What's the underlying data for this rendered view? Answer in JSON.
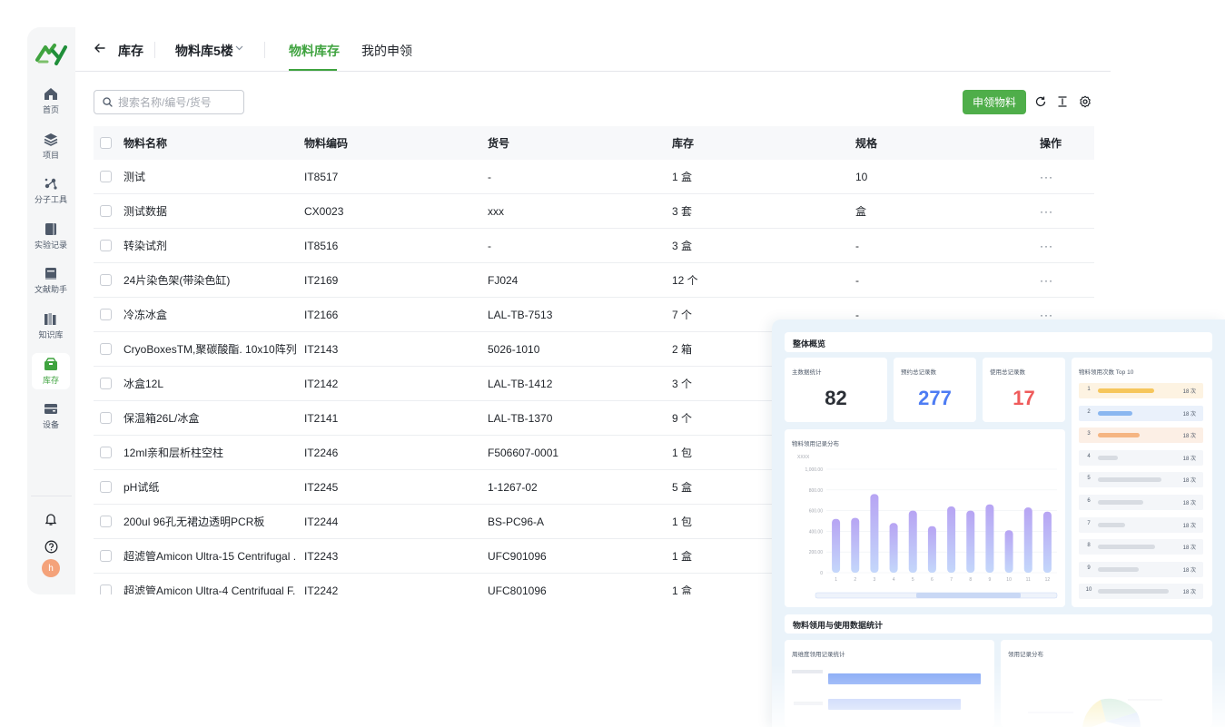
{
  "sidebar": {
    "items": [
      {
        "label": "首页",
        "icon": "home-icon"
      },
      {
        "label": "项目",
        "icon": "layers-icon"
      },
      {
        "label": "分子工具",
        "icon": "molecule-icon"
      },
      {
        "label": "实验记录",
        "icon": "notebook-icon"
      },
      {
        "label": "文献助手",
        "icon": "book-icon"
      },
      {
        "label": "知识库",
        "icon": "books-icon"
      },
      {
        "label": "库存",
        "icon": "inventory-icon",
        "active": true
      },
      {
        "label": "设备",
        "icon": "device-icon"
      }
    ],
    "avatar_letter": "h",
    "accent": "#3fa33f"
  },
  "header": {
    "breadcrumb": "库存",
    "warehouse": "物料库5楼",
    "tabs": [
      {
        "label": "物料库存",
        "active": true
      },
      {
        "label": "我的申领",
        "active": false
      }
    ]
  },
  "toolbar": {
    "search_placeholder": "搜索名称/编号/货号",
    "apply_label": "申领物料",
    "apply_color": "#4fae4a"
  },
  "table": {
    "columns": [
      "物料名称",
      "物料编码",
      "货号",
      "库存",
      "规格",
      "操作"
    ],
    "rows": [
      {
        "name": "测试",
        "code": "IT8517",
        "sku": "-",
        "stock": "1 盒",
        "spec": "10",
        "ops": "···"
      },
      {
        "name": "测试数据",
        "code": "CX0023",
        "sku": "xxx",
        "stock": "3 套",
        "spec": "盒",
        "ops": "···"
      },
      {
        "name": "转染试剂",
        "code": "IT8516",
        "sku": "-",
        "stock": "3 盒",
        "spec": "-",
        "ops": "···"
      },
      {
        "name": "24片染色架(带染色缸)",
        "code": "IT2169",
        "sku": "FJ024",
        "stock": "12 个",
        "spec": "-",
        "ops": "···"
      },
      {
        "name": "冷冻冰盒",
        "code": "IT2166",
        "sku": "LAL-TB-7513",
        "stock": "7 个",
        "spec": "-",
        "ops": "···"
      },
      {
        "name": "CryoBoxesTM,聚碳酸酯. 10x10阵列,...",
        "code": "IT2143",
        "sku": "5026-1010",
        "stock": "2 箱",
        "spec": "",
        "ops": ""
      },
      {
        "name": "冰盒12L",
        "code": "IT2142",
        "sku": "LAL-TB-1412",
        "stock": "3 个",
        "spec": "",
        "ops": ""
      },
      {
        "name": "保温箱26L/冰盒",
        "code": "IT2141",
        "sku": " LAL-TB-1370",
        "stock": "9 个",
        "spec": "",
        "ops": ""
      },
      {
        "name": "12ml亲和层析柱空柱",
        "code": "IT2246",
        "sku": "F506607-0001",
        "stock": "1 包",
        "spec": "",
        "ops": ""
      },
      {
        "name": "pH试纸",
        "code": "IT2245",
        "sku": "1-1267-02",
        "stock": "5 盒",
        "spec": "",
        "ops": ""
      },
      {
        "name": "200ul 96孔无裙边透明PCR板",
        "code": "IT2244",
        "sku": "BS-PC96-A",
        "stock": "1 包",
        "spec": "",
        "ops": ""
      },
      {
        "name": "超滤管Amicon Ultra-15 Centrifugal ...",
        "code": "IT2243",
        "sku": "UFC901096",
        "stock": "1 盒",
        "spec": "",
        "ops": ""
      },
      {
        "name": "超滤管Amicon Ultra-4 Centrifugal F...",
        "code": "IT2242",
        "sku": "UFC801096",
        "stock": "1 盒",
        "spec": "",
        "ops": ""
      }
    ]
  },
  "dashboard": {
    "overview_title": "整体概览",
    "stats": [
      {
        "label": "主数据统计",
        "value": "82",
        "color": "#2b2f36"
      },
      {
        "label": "预约总记录数",
        "value": "277",
        "color": "#4d7cf3"
      },
      {
        "label": "使用总记录数",
        "value": "17",
        "color": "#ef5b5b"
      }
    ],
    "top10": {
      "title": "物料领用次数 Top 10",
      "items": [
        {
          "rank": "1",
          "count": "18 次",
          "level": 0.62,
          "color": "#f6c65b",
          "bg": "#fdf3e2"
        },
        {
          "rank": "2",
          "count": "18 次",
          "level": 0.38,
          "color": "#8ab7f0",
          "bg": "#eaf1fb"
        },
        {
          "rank": "3",
          "count": "18 次",
          "level": 0.46,
          "color": "#f5b582",
          "bg": "#fcefe5"
        },
        {
          "rank": "4",
          "count": "18 次",
          "level": 0.22,
          "color": "#d8dce2",
          "bg": "#f4f6f9"
        },
        {
          "rank": "5",
          "count": "18 次",
          "level": 0.7,
          "color": "#d8dce2",
          "bg": "#f4f6f9"
        },
        {
          "rank": "6",
          "count": "18 次",
          "level": 0.5,
          "color": "#d8dce2",
          "bg": "#f4f6f9"
        },
        {
          "rank": "7",
          "count": "18 次",
          "level": 0.3,
          "color": "#d8dce2",
          "bg": "#f4f6f9"
        },
        {
          "rank": "8",
          "count": "18 次",
          "level": 0.63,
          "color": "#d8dce2",
          "bg": "#f4f6f9"
        },
        {
          "rank": "9",
          "count": "18 次",
          "level": 0.45,
          "color": "#d8dce2",
          "bg": "#f4f6f9"
        },
        {
          "rank": "10",
          "count": "18 次",
          "level": 0.78,
          "color": "#d8dce2",
          "bg": "#f4f6f9"
        }
      ]
    },
    "monthly_title": "物料领用记录分布",
    "stats_title": "物料领用与使用数据统计",
    "weekly_title": "周维度领用记录统计",
    "dist_title": "领用记录分布"
  },
  "chart_data": {
    "type": "bar",
    "title": "物料领用记录分布",
    "ylabel": "XXXX",
    "categories": [
      "1",
      "2",
      "3",
      "4",
      "5",
      "6",
      "7",
      "8",
      "9",
      "10",
      "11",
      "12"
    ],
    "values": [
      520,
      530,
      760,
      480,
      600,
      450,
      640,
      600,
      660,
      410,
      630,
      590
    ],
    "yticks": [
      "0",
      "200.00",
      "400.00",
      "600.00",
      "800.00",
      "1,000.00"
    ],
    "ylim": [
      0,
      1000
    ],
    "grid": true
  }
}
